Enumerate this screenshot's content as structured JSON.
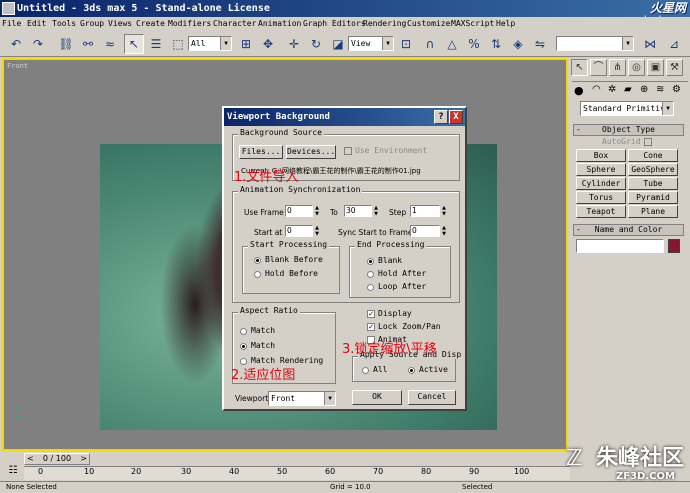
{
  "window": {
    "title": "Untitled - 3ds max 5 - Stand-alone License",
    "brand": "火星网",
    "brand_sub": "hxsd.com"
  },
  "menu": [
    "File",
    "Edit",
    "Tools",
    "Group",
    "Views",
    "Create",
    "Modifiers",
    "Character",
    "Animation",
    "Graph Editors",
    "Rendering",
    "Customize",
    "MAXScript",
    "Help"
  ],
  "toolbar": {
    "selection_filter": "All",
    "coord_system": "View",
    "named_selection": ""
  },
  "viewport": {
    "label": "Front"
  },
  "command_panel": {
    "category": "Standard Primitiv",
    "object_type": {
      "title": "Object Type",
      "autogrid": "AutoGrid",
      "buttons": [
        "Box",
        "Cone",
        "Sphere",
        "GeoSphere",
        "Cylinder",
        "Tube",
        "Torus",
        "Pyramid",
        "Teapot",
        "Plane"
      ]
    },
    "name_color": {
      "title": "Name and Color",
      "swatch_color": "#8a1530"
    }
  },
  "dialog": {
    "title": "Viewport Background",
    "help_btn": "?",
    "close_btn": "X",
    "background_source": {
      "label": "Background Source",
      "files_btn": "Files...",
      "devices_btn": "Devices...",
      "use_env": "Use Environment",
      "current": "Current: G:\\网络教程\\霸王花的制作\\霸王花的制作01.jpg"
    },
    "anim_sync": {
      "label": "Animation Synchronization",
      "use_frame_label": "Use Frame",
      "use_frame_value": "0",
      "to_label": "To",
      "to_value": "30",
      "step_label": "Step",
      "step_value": "1",
      "start_at_label": "Start at",
      "start_at_value": "0",
      "sync_label": "Sync Start to Frame",
      "sync_value": "0"
    },
    "start_processing": {
      "label": "Start Processing",
      "opt1": "Blank Before",
      "opt2": "Hold Before"
    },
    "end_processing": {
      "label": "End Processing",
      "opt1": "Blank",
      "opt2": "Hold After",
      "opt3": "Loop After"
    },
    "aspect_ratio": {
      "label": "Aspect Ratio",
      "opt1": "Match",
      "opt2": "Match",
      "opt3": "Match Rendering"
    },
    "display": "Display",
    "lock_zoom": "Lock Zoom/Pan",
    "animate": "Animat",
    "apply_source": {
      "label": "Apply Source and Disp",
      "opt1": "All",
      "opt2": "Active"
    },
    "viewport_label": "Viewport:",
    "viewport_value": "Front",
    "ok": "OK",
    "cancel": "Cancel"
  },
  "annotations": {
    "a1": "1.文件导入",
    "a2": "2.适应位图",
    "a3": "3.锁定缩放\\平移"
  },
  "timeline": {
    "slider": "0 / 100",
    "ticks": [
      "0",
      "10",
      "20",
      "30",
      "40",
      "50",
      "60",
      "70",
      "80",
      "90",
      "100"
    ]
  },
  "status": {
    "text": "None Selected",
    "grid": "Grid = 10.0",
    "selected": "Selected"
  },
  "watermark": {
    "main": "朱峰社区",
    "sub": "ZF3D.COM"
  }
}
